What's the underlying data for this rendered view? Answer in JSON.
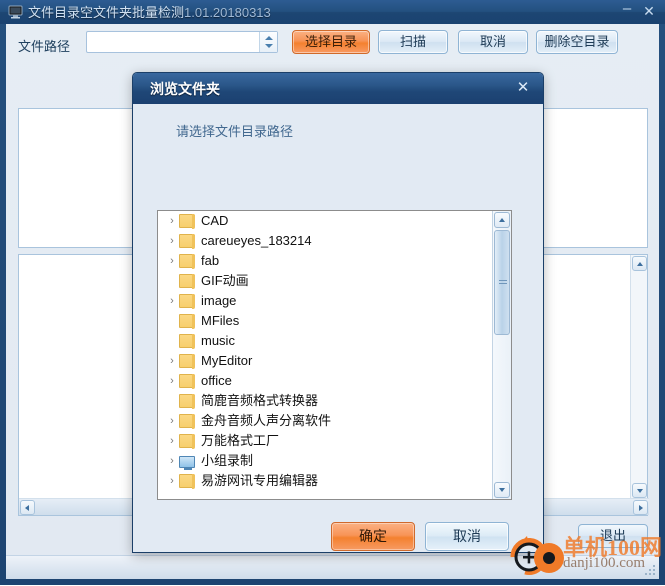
{
  "window": {
    "title": "文件目录空文件夹批量检测",
    "version": "1.01.20180313",
    "icon": "computer-icon",
    "minimize_label": "–",
    "close_label": "✕"
  },
  "toolbar": {
    "path_label": "文件路径",
    "path_value": "",
    "path_placeholder": "",
    "buttons": [
      {
        "label": "选择目录",
        "accent": true
      },
      {
        "label": "扫描",
        "accent": false
      },
      {
        "label": "取消",
        "accent": false
      },
      {
        "label": "删除空目录",
        "accent": false
      }
    ],
    "select_dir_label": "选择目录",
    "scan_label": "扫描",
    "cancel_label": "取消",
    "delete_empty_label": "删除空目录"
  },
  "main": {
    "exit_label": "退出"
  },
  "dialog": {
    "title": "浏览文件夹",
    "close_label": "✕",
    "prompt": "请选择文件目录路径",
    "ok_label": "确定",
    "cancel_label": "取消",
    "tree": [
      {
        "label": "CAD",
        "icon": "folder-icon",
        "expandable": true
      },
      {
        "label": "careueyes_183214",
        "icon": "folder-icon",
        "expandable": true
      },
      {
        "label": "fab",
        "icon": "folder-icon",
        "expandable": true
      },
      {
        "label": "GIF动画",
        "icon": "folder-icon",
        "expandable": false
      },
      {
        "label": "image",
        "icon": "folder-icon",
        "expandable": true
      },
      {
        "label": "MFiles",
        "icon": "folder-icon",
        "expandable": false
      },
      {
        "label": "music",
        "icon": "folder-icon",
        "expandable": false
      },
      {
        "label": "MyEditor",
        "icon": "folder-icon",
        "expandable": true
      },
      {
        "label": "office",
        "icon": "folder-icon",
        "expandable": true
      },
      {
        "label": "简鹿音频格式转换器",
        "icon": "folder-icon",
        "expandable": false
      },
      {
        "label": "金舟音频人声分离软件",
        "icon": "folder-icon",
        "expandable": true
      },
      {
        "label": "万能格式工厂",
        "icon": "folder-icon",
        "expandable": true
      },
      {
        "label": "小组录制",
        "icon": "monitor-icon",
        "expandable": true
      },
      {
        "label": "易游网讯专用编辑器",
        "icon": "folder-icon",
        "expandable": true
      }
    ]
  },
  "watermark": {
    "line1": "单机100网",
    "line2": "danji100.com"
  },
  "colors": {
    "titlebar": "#23507f",
    "accent_orange": "#f4812f",
    "client_bg": "#e4ebf3",
    "dialog_bg": "#e2eaf3",
    "folder_yellow": "#f7cf6d",
    "watermark_orange": "#f07a28"
  }
}
